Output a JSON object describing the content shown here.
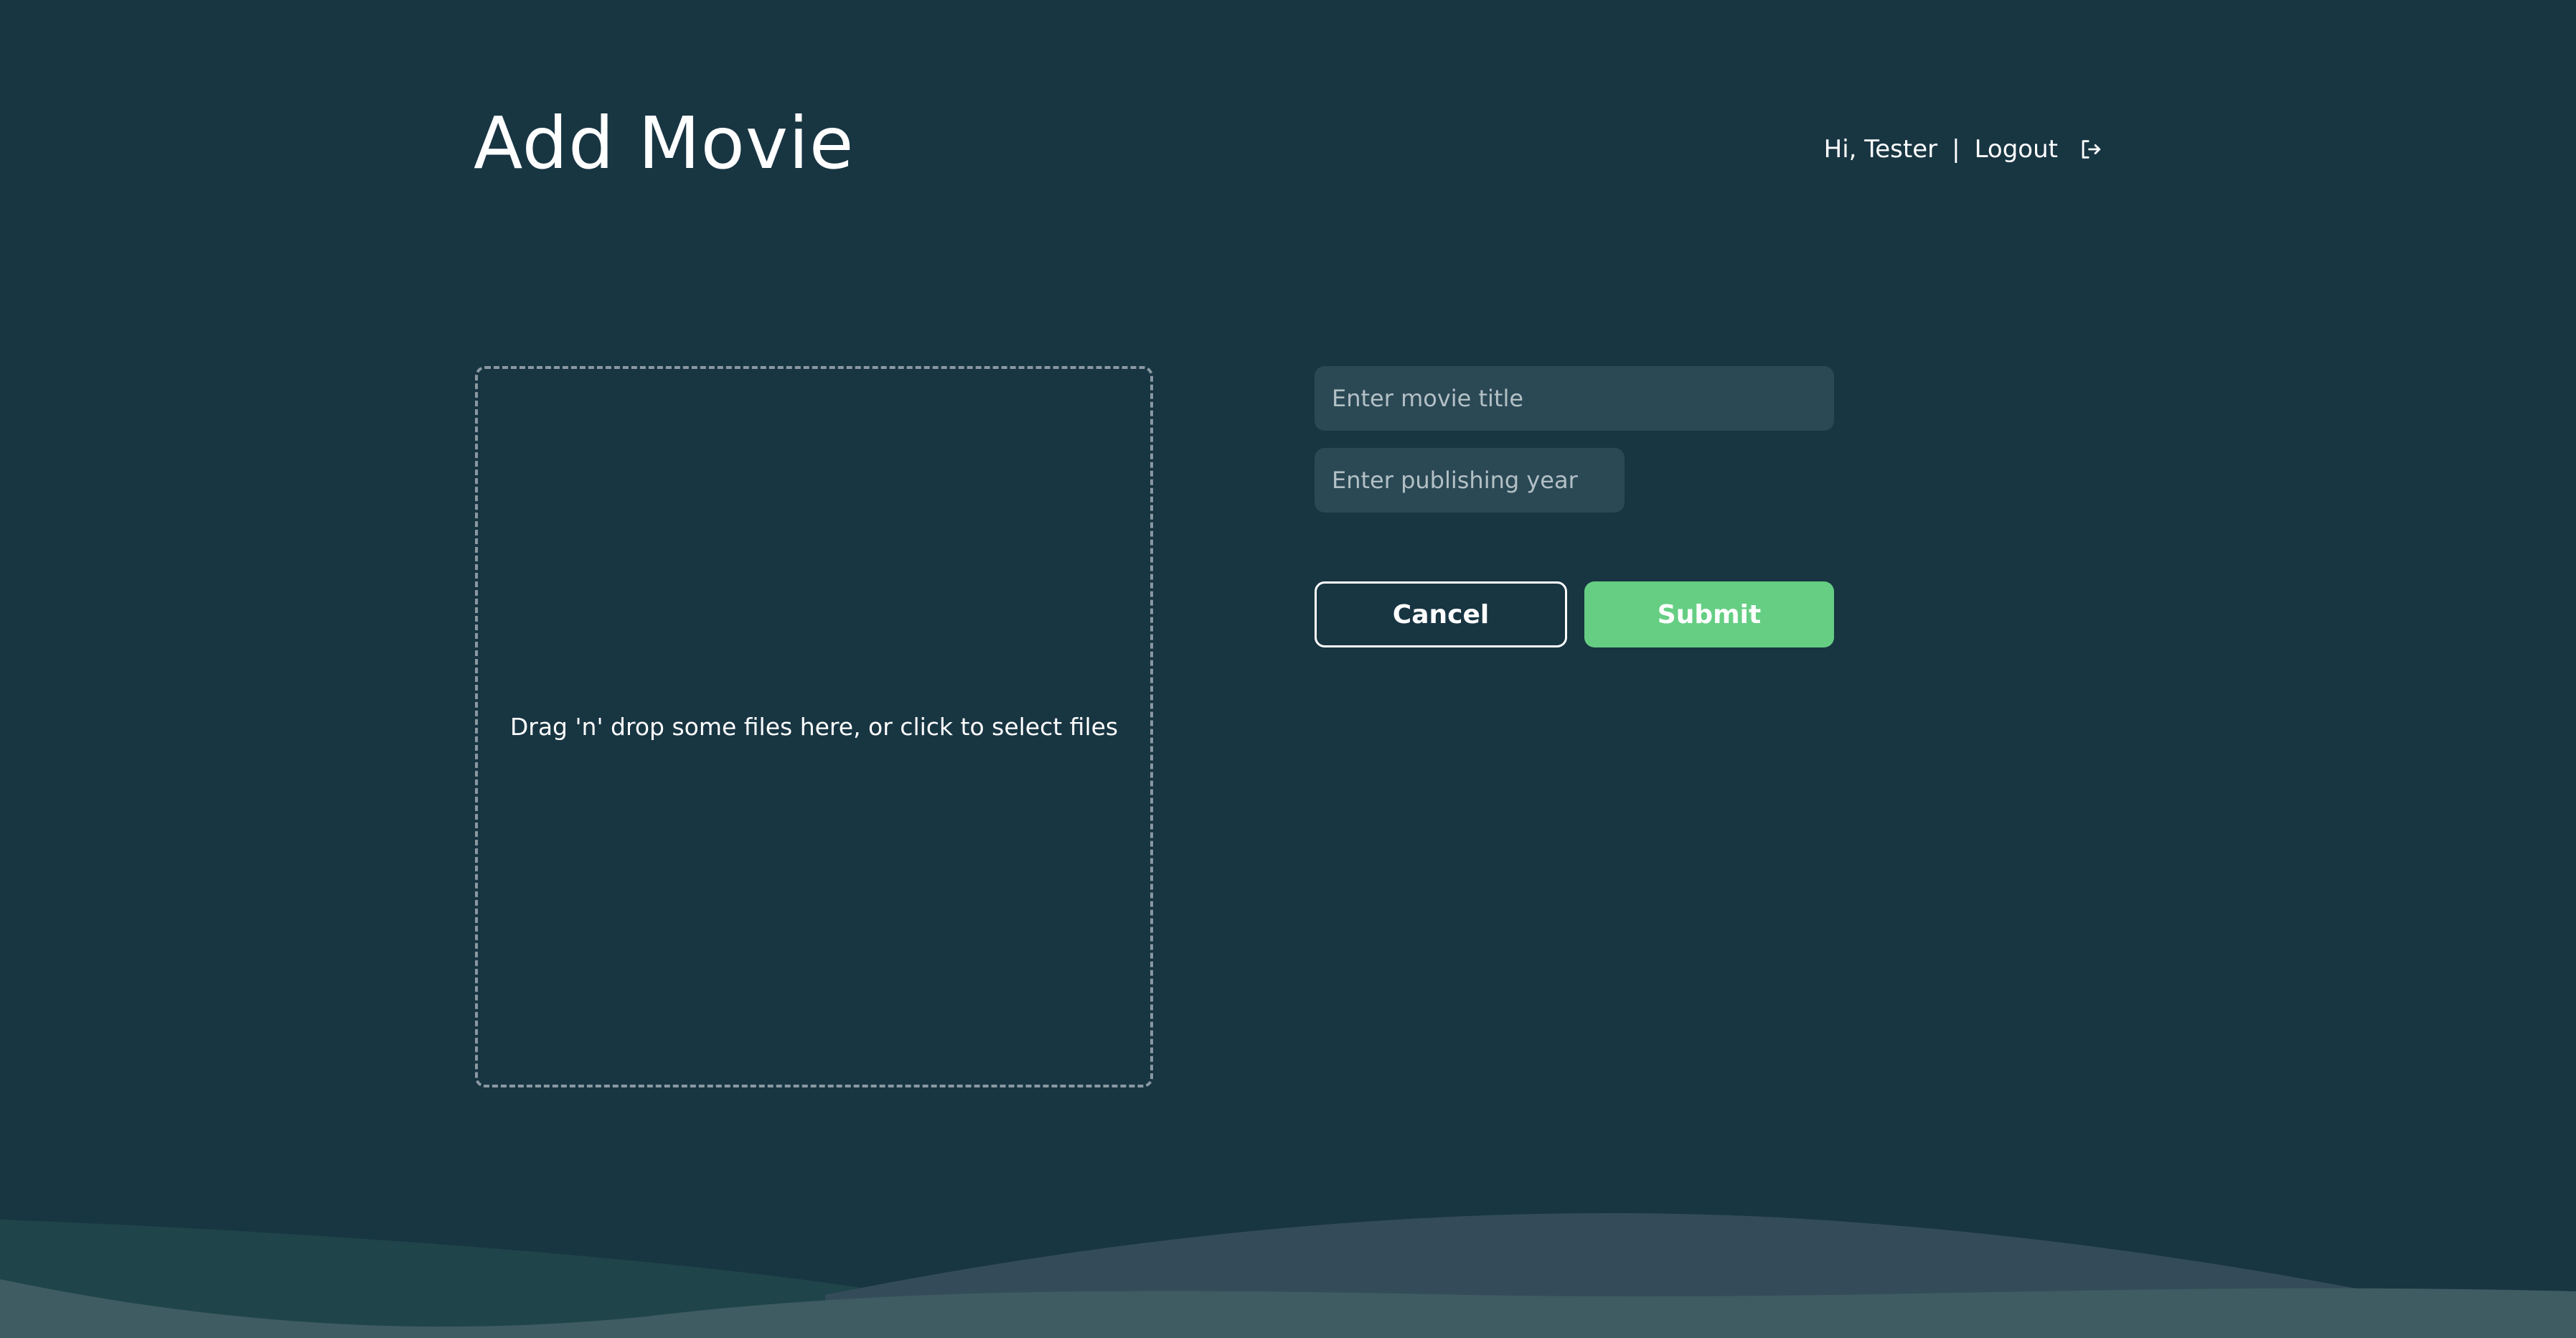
{
  "header": {
    "title": "Add Movie"
  },
  "user": {
    "greeting": "Hi, Tester",
    "separator": "|",
    "logout_label": "Logout",
    "logout_icon": "logout-icon"
  },
  "dropzone": {
    "text": "Drag 'n' drop some files here, or click to select files"
  },
  "form": {
    "title_placeholder": "Enter movie title",
    "title_value": "",
    "year_placeholder": "Enter publishing year",
    "year_value": "",
    "cancel_label": "Cancel",
    "submit_label": "Submit"
  },
  "colors": {
    "background": "#183542",
    "input_background": "#2b4955",
    "accent": "#65ce83",
    "wave_dark": "#1f4449",
    "wave_mid": "#344c59",
    "wave_light": "#3e5c62"
  }
}
